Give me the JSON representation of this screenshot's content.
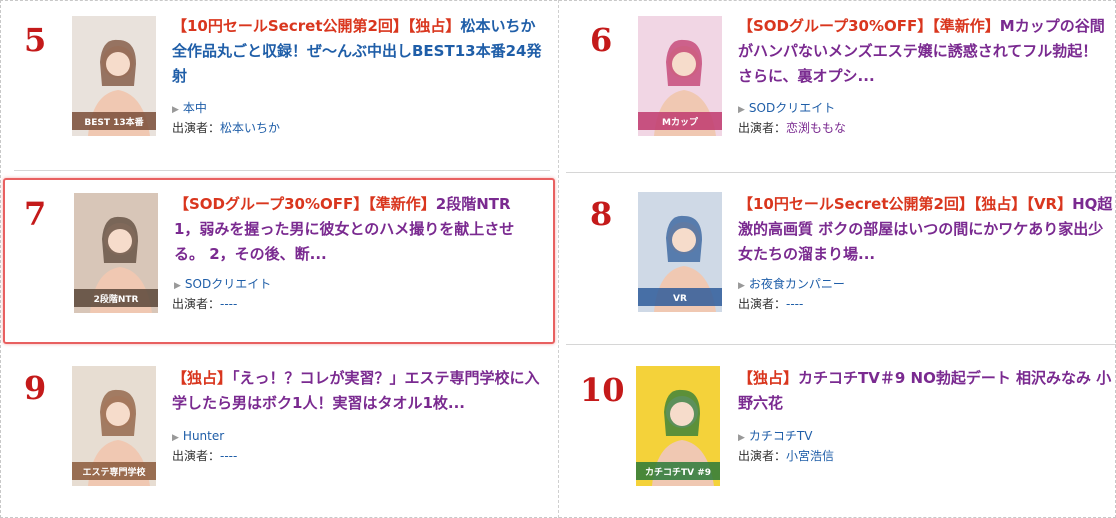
{
  "actors_label": "出演者：",
  "cards": [
    {
      "rank": "5",
      "thumb": {
        "icon": "dvd-cover-thumbnail",
        "bg": "#e9e2dc",
        "accent": "#7a4e38",
        "text": "BEST 13本番"
      },
      "tags": [
        "【10円セールSecret公開第2回】",
        "【独占】"
      ],
      "title": "松本いちか全作品丸ごと収録！ぜ～んぶ中出しBEST13本番24発射",
      "label": "本中",
      "actors": "松本いちか"
    },
    {
      "rank": "6",
      "thumb": {
        "icon": "dvd-cover-thumbnail",
        "bg": "#f1d6e4",
        "accent": "#c0396e",
        "text": "Mカップ"
      },
      "tags": [
        "【SODグループ30%OFF】",
        "【準新作】"
      ],
      "title": "Mカップの谷間がハンパないメンズエステ嬢に誘惑されてフル勃起！ さらに、裏オプシ...",
      "label": "SODクリエイト",
      "actors": "恋渕ももな"
    },
    {
      "rank": "7",
      "thumb": {
        "icon": "dvd-cover-thumbnail",
        "bg": "#d8c6b8",
        "accent": "#5a4638",
        "text": "2段階NTR"
      },
      "tags": [
        "【SODグループ30%OFF】",
        "【準新作】"
      ],
      "title": "2段階NTR 1，弱みを握った男に彼女とのハメ撮りを献上させる。 2，その後、断...",
      "label": "SODクリエイト",
      "actors": "----"
    },
    {
      "rank": "8",
      "thumb": {
        "icon": "dvd-cover-thumbnail",
        "bg": "#cfd9e6",
        "accent": "#2f5c9a",
        "text": "VR"
      },
      "tags": [
        "【10円セールSecret公開第2回】",
        "【独占】",
        "【VR】"
      ],
      "title": "HQ超激的高画質 ボクの部屋はいつの間にかワケあり家出少女たちの溜まり場...",
      "label": "お夜食カンパニー",
      "actors": "----"
    },
    {
      "rank": "9",
      "thumb": {
        "icon": "dvd-cover-thumbnail",
        "bg": "#e7ddd2",
        "accent": "#8b5a3c",
        "text": "エステ専門学校"
      },
      "tags": [
        "【独占】"
      ],
      "title": "「えっ！？コレが実習？」エステ専門学校に入学したら男はボク1人！実習はタオル1枚...",
      "label": "Hunter",
      "actors": "----"
    },
    {
      "rank": "10",
      "thumb": {
        "icon": "dvd-cover-thumbnail",
        "bg": "#f4d23a",
        "accent": "#2a7a3a",
        "text": "カチコチTV #9"
      },
      "tags": [
        "【独占】"
      ],
      "title": "カチコチTV＃9 NO勃起デート 相沢みなみ 小野六花",
      "label": "カチコチTV",
      "actors": "小宮浩信"
    }
  ]
}
